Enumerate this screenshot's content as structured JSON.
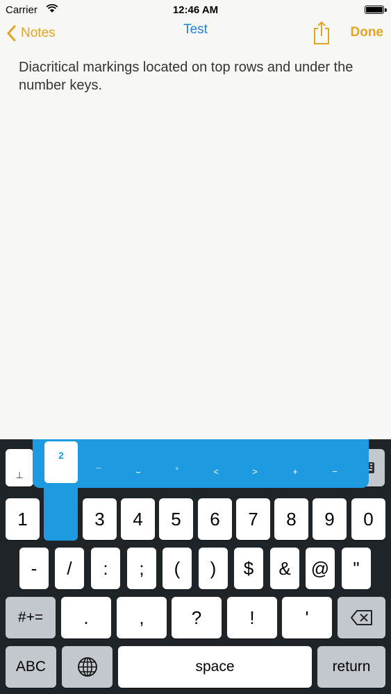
{
  "status": {
    "carrier": "Carrier",
    "time": "12:46 AM"
  },
  "nav": {
    "back_label": "Notes",
    "title": "Test",
    "done_label": "Done"
  },
  "note": {
    "text": "Diacritical markings located on top rows and under the number keys."
  },
  "keyboard": {
    "row0": {
      "left_glyph": "⊥",
      "right_icon": "keyboard-icon"
    },
    "row1": [
      "1",
      "2",
      "3",
      "4",
      "5",
      "6",
      "7",
      "8",
      "9",
      "0"
    ],
    "row2": [
      "-",
      "/",
      ":",
      ";",
      "(",
      ")",
      "$",
      "&",
      "@",
      "\""
    ],
    "row3": {
      "mode": "#+=",
      "keys": [
        ".",
        ",",
        "?",
        "!",
        "'"
      ]
    },
    "row4": {
      "abc": "ABC",
      "space": "space",
      "return": "return"
    }
  },
  "popup": {
    "selected": "2",
    "options": [
      "¯",
      "⌣",
      "˚",
      "˂",
      "˃",
      "+",
      "−"
    ]
  },
  "colors": {
    "accent": "#e3a421",
    "title": "#1f7fe0",
    "popup": "#1e9be0",
    "keyboard_bg": "#1f2429"
  }
}
